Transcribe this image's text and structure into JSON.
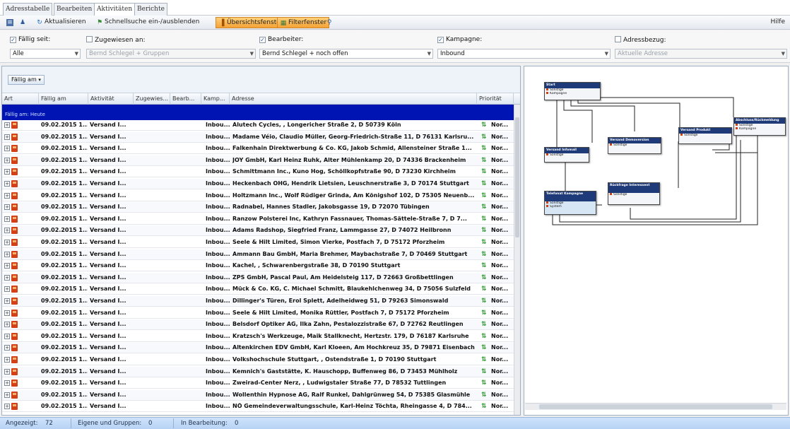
{
  "tabs": [
    "Adresstabelle",
    "Bearbeiten",
    "Aktivitäten",
    "Berichte"
  ],
  "active_tab": 2,
  "toolbar": {
    "refresh": "Aktualisieren",
    "quicksearch": "Schnellsuche ein-/ausblenden",
    "overview": "Übersichtsfenster",
    "filter": "Filterfenster",
    "help": "Hilfe"
  },
  "filters": [
    {
      "label": "Fällig seit:",
      "checked": true,
      "value": "Alle",
      "disabled": false
    },
    {
      "label": "Zugewiesen an:",
      "checked": false,
      "value": "Bernd Schlegel + Gruppen",
      "disabled": true
    },
    {
      "label": "Bearbeiter:",
      "checked": true,
      "value": "Bernd Schlegel + noch offen",
      "disabled": false
    },
    {
      "label": "Kampagne:",
      "checked": true,
      "value": "Inbound",
      "disabled": false
    },
    {
      "label": "Adressbezug:",
      "checked": false,
      "value": "Aktuelle Adresse",
      "disabled": true
    }
  ],
  "grid": {
    "group_chip": "Fällig am",
    "columns": [
      "Art",
      "Fällig am",
      "Aktivität",
      "Zugewies...",
      "Bearb...",
      "Kamp...",
      "Adresse",
      "Priorität"
    ],
    "group_label": "Fällig am: Heute",
    "rows": [
      {
        "date": "09.02.2015 1...",
        "activity": "Versand I...",
        "campaign": "Inbou...",
        "address": "Alutech Cycles, , Longericher Straße 2, D 50739 Köln",
        "prio": "Nor..."
      },
      {
        "date": "09.02.2015 1...",
        "activity": "Versand I...",
        "campaign": "Inbou...",
        "address": "Madame Véio, Claudio Müller, Georg-Friedrich-Straße 11, D 76131 Karlsru...",
        "prio": "Nor..."
      },
      {
        "date": "09.02.2015 1...",
        "activity": "Versand I...",
        "campaign": "Inbou...",
        "address": "Falkenhain Direktwerbung & Co. KG, Jakob Schmid, Allensteiner Straße 1...",
        "prio": "Nor..."
      },
      {
        "date": "09.02.2015 1...",
        "activity": "Versand I...",
        "campaign": "Inbou...",
        "address": "JOY GmbH, Karl Heinz Ruhk, Alter Mühlenkamp 20, D 74336 Brackenheim",
        "prio": "Nor..."
      },
      {
        "date": "09.02.2015 1...",
        "activity": "Versand I...",
        "campaign": "Inbou...",
        "address": "Schmittmann Inc., Kuno Hog, Schöllkopfstraße 90, D 73230 Kirchheim",
        "prio": "Nor..."
      },
      {
        "date": "09.02.2015 1...",
        "activity": "Versand I...",
        "campaign": "Inbou...",
        "address": "Heckenbach OHG, Hendrik Lietsien, Leuschnerstraße 3, D 70174 Stuttgart",
        "prio": "Nor..."
      },
      {
        "date": "09.02.2015 1...",
        "activity": "Versand I...",
        "campaign": "Inbou...",
        "address": "Holtzmann Inc., Wolf Rüdiger Grinda, Am Königshof 102, D 75305 Neuenb...",
        "prio": "Nor..."
      },
      {
        "date": "09.02.2015 1...",
        "activity": "Versand I...",
        "campaign": "Inbou...",
        "address": "Radnabel, Hannes Stadler, Jakobsgasse 19, D 72070 Tübingen",
        "prio": "Nor..."
      },
      {
        "date": "09.02.2015 1...",
        "activity": "Versand I...",
        "campaign": "Inbou...",
        "address": "Ranzow Polsterei Inc, Kathryn Fassnauer, Thomas-Sättele-Straße 7, D 7...",
        "prio": "Nor..."
      },
      {
        "date": "09.02.2015 1...",
        "activity": "Versand I...",
        "campaign": "Inbou...",
        "address": "Adams Radshop, Siegfried Franz, Lammgasse 27, D 74072 Heilbronn",
        "prio": "Nor..."
      },
      {
        "date": "09.02.2015 1...",
        "activity": "Versand I...",
        "campaign": "Inbou...",
        "address": "Seele & Hilt Limited, Simon Vierke, Postfach 7, D 75172 Pforzheim",
        "prio": "Nor..."
      },
      {
        "date": "09.02.2015 1...",
        "activity": "Versand I...",
        "campaign": "Inbou...",
        "address": "Ammann Bau GmbH, Maria Brehmer, Maybachstraße 7, D 70469 Stuttgart",
        "prio": "Nor..."
      },
      {
        "date": "09.02.2015 1...",
        "activity": "Versand I...",
        "campaign": "Inbou...",
        "address": "Kachel, , Schwarenbergstraße 38, D 70190 Stuttgart",
        "prio": "Nor..."
      },
      {
        "date": "09.02.2015 1...",
        "activity": "Versand I...",
        "campaign": "Inbou...",
        "address": "ZPS GmbH, Pascal Paul, Am Heidelsteig 117, D 72663 Großbettlingen",
        "prio": "Nor..."
      },
      {
        "date": "09.02.2015 1...",
        "activity": "Versand I...",
        "campaign": "Inbou...",
        "address": "Mück & Co. KG, C. Michael Schmitt, Blaukehlchenweg 34, D 75056 Sulzfeld",
        "prio": "Nor..."
      },
      {
        "date": "09.02.2015 1...",
        "activity": "Versand I...",
        "campaign": "Inbou...",
        "address": "Dillinger's Türen, Erol Splett, Adelheidweg 51, D 79263 Simonswald",
        "prio": "Nor..."
      },
      {
        "date": "09.02.2015 1...",
        "activity": "Versand I...",
        "campaign": "Inbou...",
        "address": "Seele & Hilt Limited, Monika Rüttler, Postfach 7, D 75172 Pforzheim",
        "prio": "Nor..."
      },
      {
        "date": "09.02.2015 1...",
        "activity": "Versand I...",
        "campaign": "Inbou...",
        "address": "Belsdorf Optiker AG, Ilka Zahn, Pestalozzistraße 67, D 72762 Reutlingen",
        "prio": "Nor..."
      },
      {
        "date": "09.02.2015 1...",
        "activity": "Versand I...",
        "campaign": "Inbou...",
        "address": "Kratzsch's Werkzeuge, Maik Stallknecht, Hertzstr. 179, D 76187 Karlsruhe",
        "prio": "Nor..."
      },
      {
        "date": "09.02.2015 1...",
        "activity": "Versand I...",
        "campaign": "Inbou...",
        "address": "Altenkirchen EDV GmbH, Karl Kloeen, Am Hochkreuz 35, D 79871 Eisenbach",
        "prio": "Nor..."
      },
      {
        "date": "09.02.2015 1...",
        "activity": "Versand I...",
        "campaign": "Inbou...",
        "address": "Volkshochschule Stuttgart, , Ostendstraße 1, D 70190 Stuttgart",
        "prio": "Nor..."
      },
      {
        "date": "09.02.2015 1...",
        "activity": "Versand I...",
        "campaign": "Inbou...",
        "address": "Kemnich's Gaststätte, K. Hauschopp, Buffenweg 86, D 73453 Mühlholz",
        "prio": "Nor..."
      },
      {
        "date": "09.02.2015 1...",
        "activity": "Versand I...",
        "campaign": "Inbou...",
        "address": "Zweirad-Center Nerz, , Ludwigstaler Straße 77, D 78532 Tuttlingen",
        "prio": "Nor..."
      },
      {
        "date": "09.02.2015 1...",
        "activity": "Versand I...",
        "campaign": "Inbou...",
        "address": "Wollenthin Hypnose AG, Ralf Runkel, Dahlgrünweg 54, D 75385 Glasmühle",
        "prio": "Nor..."
      },
      {
        "date": "09.02.2015 1...",
        "activity": "Versand I...",
        "campaign": "Inbou...",
        "address": "NÖ Gemeindeverwaltungsschule, Karl-Heinz Töchta, Rheingasse 4, D 784...",
        "prio": "Nor..."
      }
    ]
  },
  "diagram": {
    "nodes": [
      {
        "title": "Start",
        "rows": [
          "Sonstige",
          "Kampagne"
        ]
      },
      {
        "title": "Versand Infomail",
        "rows": [
          "Sonstige"
        ]
      },
      {
        "title": "Versand Demoversion",
        "rows": [
          "Sonstige"
        ]
      },
      {
        "title": "Versand Produkt",
        "rows": [
          "Sonstige"
        ]
      },
      {
        "title": "Abschluss/Rückmeldung",
        "rows": [
          "Sonstige",
          "Kampagne"
        ]
      },
      {
        "title": "Telefonat Kampagne",
        "rows": [
          "Sonstige",
          "System"
        ]
      },
      {
        "title": "Rückfrage Interessent",
        "rows": [
          "Sonstige"
        ]
      }
    ]
  },
  "status": {
    "shown_label": "Angezeigt:",
    "shown_value": "72",
    "own_label": "Eigene und Gruppen:",
    "own_value": "0",
    "work_label": "In Bearbeitung:",
    "work_value": "0"
  }
}
